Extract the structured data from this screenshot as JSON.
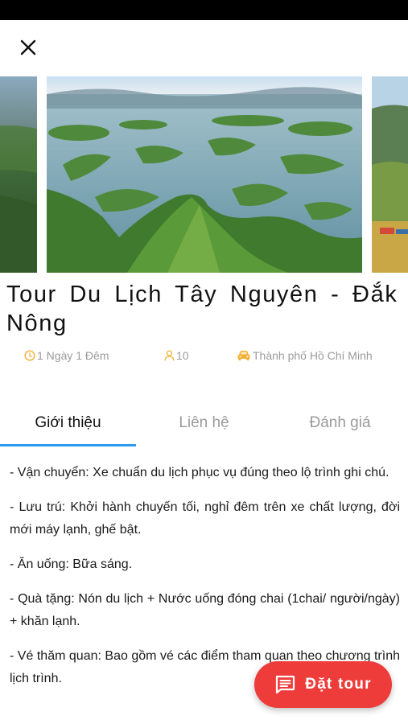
{
  "tour": {
    "title": "Tour Du Lịch Tây Nguyên - Đắk Nông",
    "duration": "1 Ngày 1 Đêm",
    "people": "10",
    "departure": "Thành phố Hồ Chí Minh"
  },
  "tabs": [
    {
      "label": "Giới thiệu",
      "active": true
    },
    {
      "label": "Liên hệ",
      "active": false
    },
    {
      "label": "Đánh giá",
      "active": false
    }
  ],
  "intro": [
    "- Vận chuyển: Xe chuẩn du lịch phục vụ đúng theo lộ trình ghi chú.",
    "- Lưu trú: Khởi hành chuyến tối, nghỉ đêm trên xe chất lượng, đời mới máy lạnh, ghế bật.",
    "- Ăn uống: Bữa sáng.",
    "- Quà tặng: Nón du lịch + Nước uống đóng chai (1chai/ người/ngày) + khăn lạnh.",
    "- Vé thăm quan: Bao gồm vé các điểm tham quan theo chương trình lịch trình."
  ],
  "fab": {
    "label": "Đặt tour",
    "icon": "message-icon"
  },
  "colors": {
    "accent": "#2d9bf0",
    "fab": "#ee3c3a",
    "meta_icon": "#f2b134"
  },
  "icons": {
    "close": "close-icon",
    "duration": "clock-icon",
    "people": "person-icon",
    "departure": "car-icon"
  }
}
